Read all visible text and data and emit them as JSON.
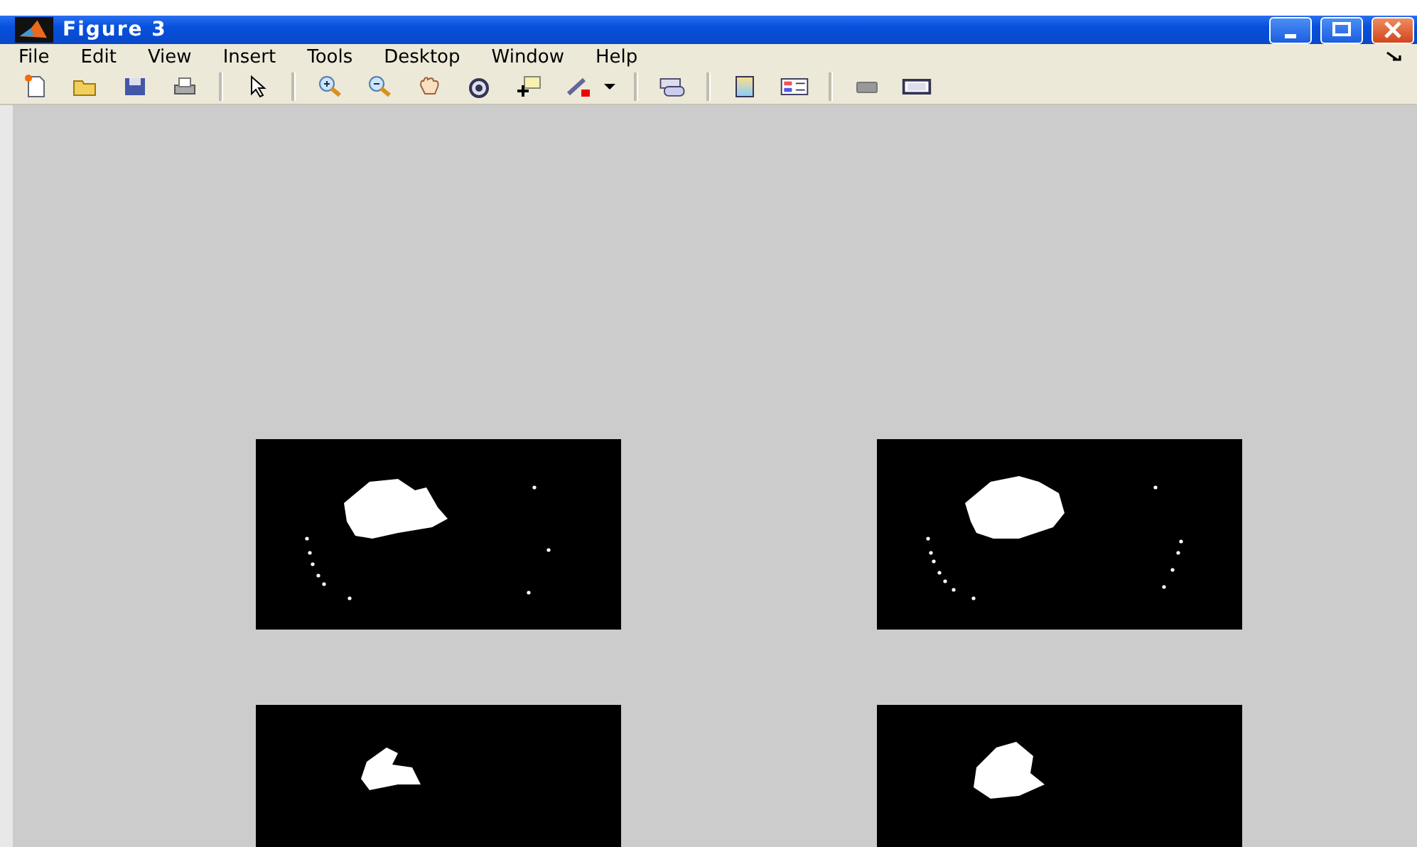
{
  "window": {
    "title": "Figure 3"
  },
  "menu": [
    "File",
    "Edit",
    "View",
    "Insert",
    "Tools",
    "Desktop",
    "Window",
    "Help"
  ]
}
